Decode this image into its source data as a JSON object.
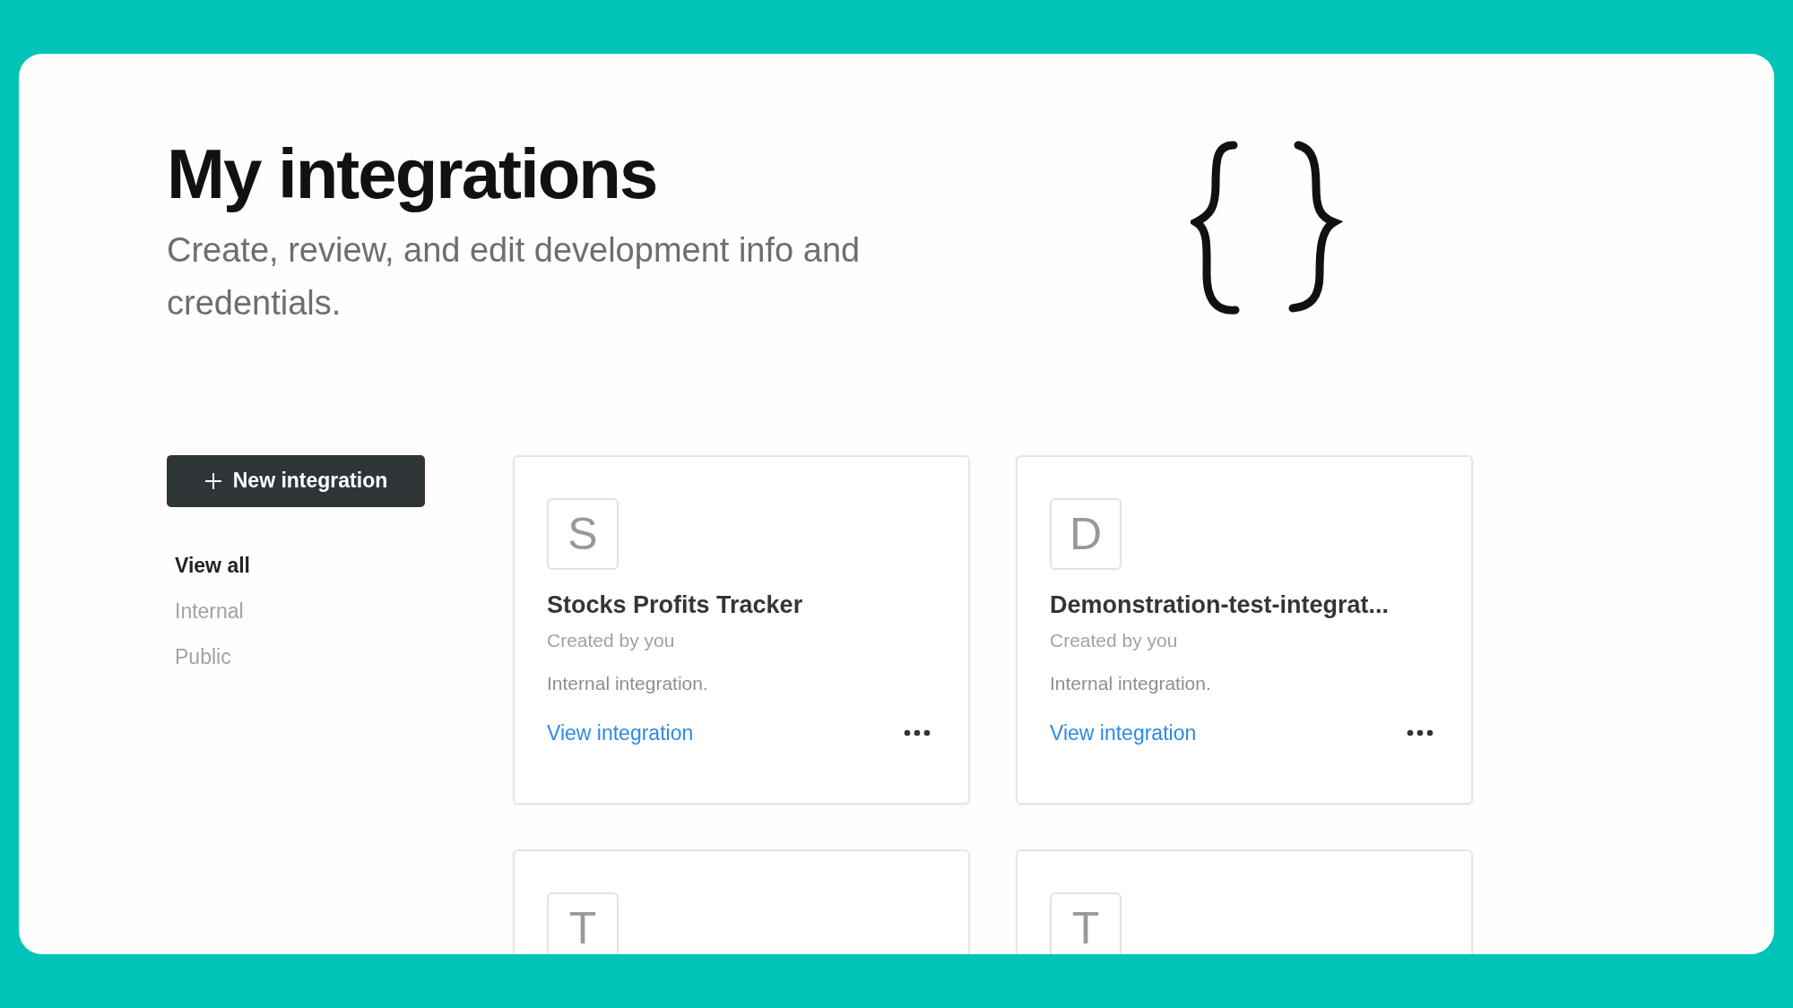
{
  "page": {
    "title": "My integrations",
    "subtitle": "Create, review, and edit development info and credentials."
  },
  "new_button": {
    "label": "New integration"
  },
  "filters": [
    {
      "label": "View all",
      "selected": true
    },
    {
      "label": "Internal",
      "selected": false
    },
    {
      "label": "Public",
      "selected": false
    }
  ],
  "integrations": [
    {
      "initial": "S",
      "name": "Stocks Profits Tracker",
      "creator": "Created by you",
      "type": "Internal integration.",
      "link": "View integration"
    },
    {
      "initial": "D",
      "name": "Demonstration-test-integrat...",
      "creator": "Created by you",
      "type": "Internal integration.",
      "link": "View integration"
    },
    {
      "initial": "T"
    },
    {
      "initial": "T"
    }
  ]
}
